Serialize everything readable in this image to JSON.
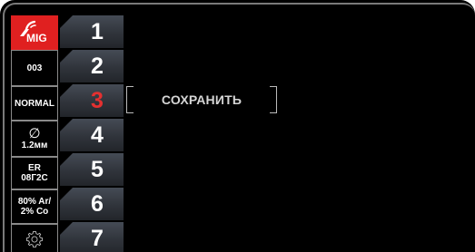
{
  "sidebar": {
    "process_label": "MIG",
    "program_number": "003",
    "mode": "NORMAL",
    "diameter_symbol": "∅",
    "diameter_value": "1.2мм",
    "wire_line1": "ER",
    "wire_line2": "08Г2С",
    "gas_line1": "80% Ar/",
    "gas_line2": "2% Co",
    "colors": {
      "accent": "#e02020",
      "border": "#8a8a8a"
    }
  },
  "memory_slots": {
    "labels": [
      "1",
      "2",
      "3",
      "4",
      "5",
      "6",
      "7"
    ],
    "active": "3",
    "active_color": "#e53030"
  },
  "save_button": {
    "label": "СОХРАНИТЬ"
  },
  "icons": [
    "torch-icon",
    "gear-icon"
  ]
}
